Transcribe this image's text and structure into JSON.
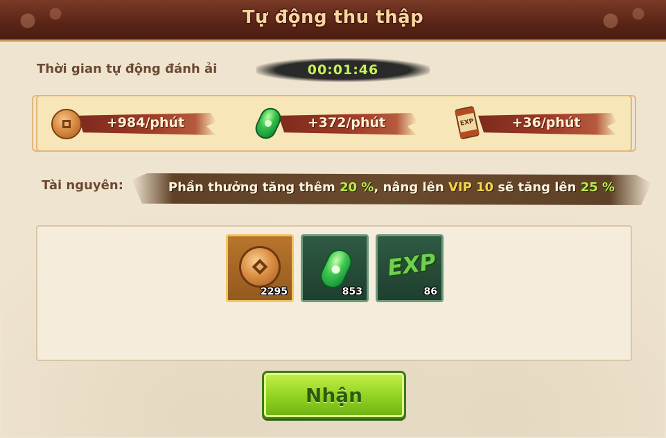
{
  "window": {
    "title": "Tự động thu thập"
  },
  "auto_time": {
    "label": "Thời gian tự động đánh ải",
    "value": "00:01:46"
  },
  "rates": [
    {
      "icon": "coin-icon",
      "value": "+984/phút"
    },
    {
      "icon": "jade-icon",
      "value": "+372/phút"
    },
    {
      "icon": "exp-scroll-icon",
      "value": "+36/phút"
    }
  ],
  "resources": {
    "label": "Tài nguyên:",
    "bonus_parts": {
      "p1": "Phần thưởng tăng thêm ",
      "bonus": "20 %",
      "p2": ", nâng lên ",
      "vip": "VIP 10",
      "p3": " sẽ tăng lên ",
      "vip_bonus": "25 %"
    },
    "items": [
      {
        "icon": "coin-icon",
        "count": "2295"
      },
      {
        "icon": "jade-icon",
        "count": "853"
      },
      {
        "icon": "exp-icon",
        "label": "EXP",
        "count": "86"
      }
    ]
  },
  "claim_button": {
    "label": "Nhận"
  },
  "colors": {
    "accent_green": "#b5ef4a",
    "vip_yellow": "#f6d54a",
    "title": "#f7d6a0"
  }
}
